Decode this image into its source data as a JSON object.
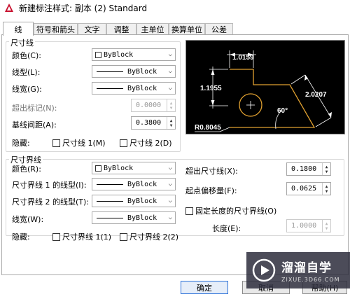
{
  "window": {
    "title": "新建标注样式: 副本 (2) Standard"
  },
  "tabs": [
    "线",
    "符号和箭头",
    "文字",
    "调整",
    "主单位",
    "换算单位",
    "公差"
  ],
  "dimline": {
    "group_title": "尺寸线",
    "color_label": "颜色(C):",
    "color_value": "ByBlock",
    "linetype_label": "线型(L):",
    "linetype_value": "ByBlock",
    "lineweight_label": "线宽(G):",
    "lineweight_value": "ByBlock",
    "extend_ticks_label": "超出标记(N):",
    "extend_ticks_value": "0.0000",
    "baseline_label": "基线间距(A):",
    "baseline_value": "0.3800",
    "suppress_label": "隐藏:",
    "suppress_1": "尺寸线 1(M)",
    "suppress_2": "尺寸线 2(D)"
  },
  "extline": {
    "group_title": "尺寸界线",
    "color_label": "颜色(R):",
    "color_value": "ByBlock",
    "lt1_label": "尺寸界线 1 的线型(I):",
    "lt1_value": "ByBlock",
    "lt2_label": "尺寸界线 2 的线型(T):",
    "lt2_value": "ByBlock",
    "lineweight_label": "线宽(W):",
    "lineweight_value": "ByBlock",
    "suppress_label": "隐藏:",
    "suppress_1": "尺寸界线 1(1)",
    "suppress_2": "尺寸界线 2(2)",
    "extend_label": "超出尺寸线(X):",
    "extend_value": "0.1800",
    "offset_label": "起点偏移量(F):",
    "offset_value": "0.0625",
    "fixed_label": "固定长度的尺寸界线(O)",
    "length_label": "长度(E):",
    "length_value": "1.0000"
  },
  "preview": {
    "dim_top": "1.0159",
    "dim_left": "1.1955",
    "dim_right": "2.0207",
    "dim_angle": "60°",
    "dim_radius": "R0.8045"
  },
  "buttons": {
    "ok": "确定",
    "cancel": "取消",
    "help": "帮助(H)"
  },
  "watermark": {
    "name": "溜溜自学",
    "url": "ZIXUE.3D66.COM"
  },
  "colors": {
    "accent": "#2a70d8",
    "preview_bg": "#000000",
    "dim_line": "#ffffff",
    "shape": "#e0a030"
  }
}
